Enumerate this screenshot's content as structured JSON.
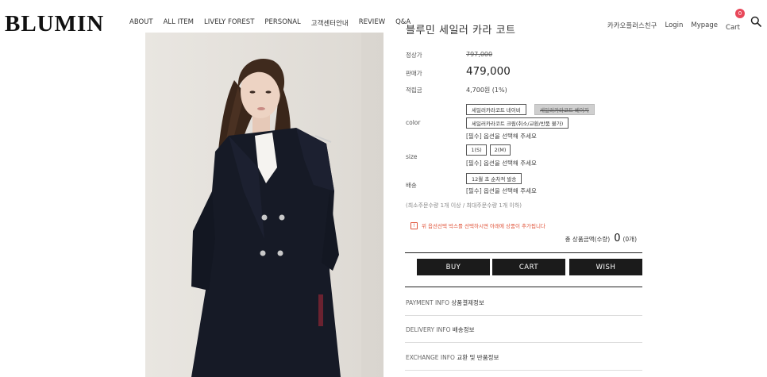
{
  "brand": {
    "logo": "BLUMIN"
  },
  "nav": [
    "ABOUT",
    "ALL ITEM",
    "LIVELY FOREST",
    "PERSONAL",
    "고객센터안내",
    "REVIEW",
    "Q&A"
  ],
  "utility": {
    "kakao": "카카오플러스친구",
    "login": "Login",
    "mypage": "Mypage",
    "cart": "Cart",
    "cart_count": "0"
  },
  "product": {
    "title": "블루민 세일러 카라 코트",
    "regular_label": "정상가",
    "regular_price": "797,000",
    "sale_label": "판매가",
    "sale_price": "479,000",
    "points_label": "적립금",
    "points_value": "4,700원 (1%)"
  },
  "options": {
    "color_label": "color",
    "color_1": "세일러카라코트 네이비",
    "color_2": "세일러카라코트 베이지",
    "color_3": "세일러카라코트 크림(취소/교환/반품 불가)",
    "color_note": "[필수] 옵션을 선택해 주세요",
    "size_label": "size",
    "size_1": "1(S)",
    "size_2": "2(M)",
    "size_note": "[필수] 옵션을 선택해 주세요",
    "ship_label": "배송",
    "ship_1": "12월 초 순차적 발송",
    "ship_note": "[필수] 옵션을 선택해 주세요"
  },
  "order": {
    "min_order": "(최소주문수량 1개 이상 / 최대주문수량 1개 이하)",
    "warning": "위 옵션선택 박스를 선택하시면 아래에 상품이 추가됩니다",
    "total_label": "총 상품금액(수량)",
    "total_qty": "0",
    "total_count": "(0개)"
  },
  "actions": {
    "buy": "BUY",
    "cart": "CART",
    "wish": "WISH"
  },
  "accordion": [
    {
      "en": "PAYMENT INFO",
      "kr": "상품결제정보"
    },
    {
      "en": "DELIVERY INFO",
      "kr": "배송정보"
    },
    {
      "en": "EXCHANGE INFO",
      "kr": "교환 및 반품정보"
    }
  ],
  "colors": {
    "accent_badge": "#e8485a",
    "warning": "#e0543a",
    "button_dark": "#1b1b1b",
    "coat_navy": "#161a26"
  }
}
